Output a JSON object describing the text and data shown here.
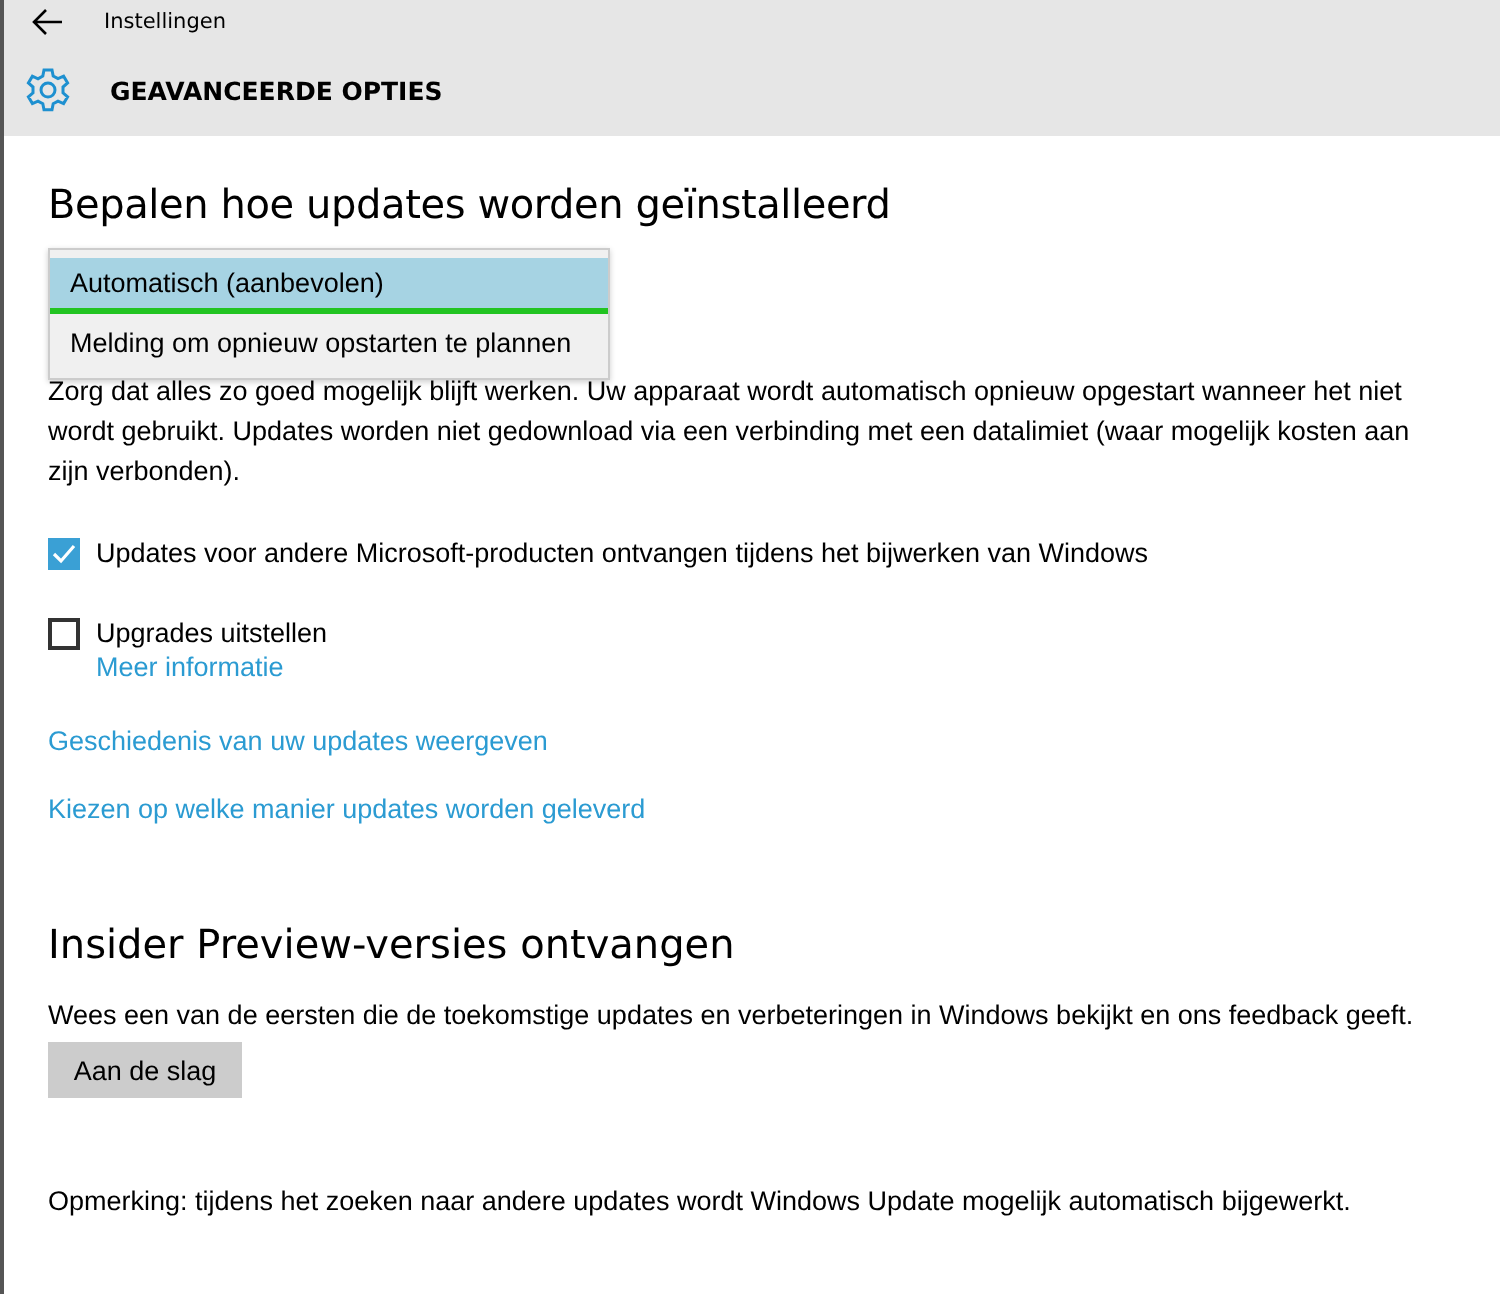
{
  "window": {
    "title": "Instellingen"
  },
  "header": {
    "title": "GEAVANCEERDE OPTIES"
  },
  "install_section": {
    "heading": "Bepalen hoe updates worden geïnstalleerd",
    "dropdown": {
      "options": [
        {
          "label": "Automatisch (aanbevolen)",
          "selected": true
        },
        {
          "label": "Melding om opnieuw opstarten te plannen",
          "selected": false
        }
      ]
    },
    "description": "Zorg dat alles zo goed mogelijk blijft werken. Uw apparaat wordt automatisch opnieuw opgestart wanneer het niet wordt gebruikt. Updates worden niet gedownload via een verbinding met een datalimiet (waar mogelijk kosten aan zijn verbonden).",
    "checkboxes": [
      {
        "label": "Updates voor andere Microsoft-producten ontvangen tijdens het bijwerken van Windows",
        "checked": true
      },
      {
        "label": "Upgrades uitstellen",
        "checked": false,
        "link": "Meer informatie"
      }
    ],
    "links": [
      "Geschiedenis van uw updates weergeven",
      "Kiezen op welke manier updates worden geleverd"
    ]
  },
  "insider_section": {
    "heading": "Insider Preview-versies ontvangen",
    "text": "Wees een van de eersten die de toekomstige updates en verbeteringen in Windows bekijkt en ons feedback geeft.",
    "button": "Aan de slag"
  },
  "note": "Opmerking: tijdens het zoeken naar andere updates wordt Windows Update mogelijk automatisch bijgewerkt."
}
